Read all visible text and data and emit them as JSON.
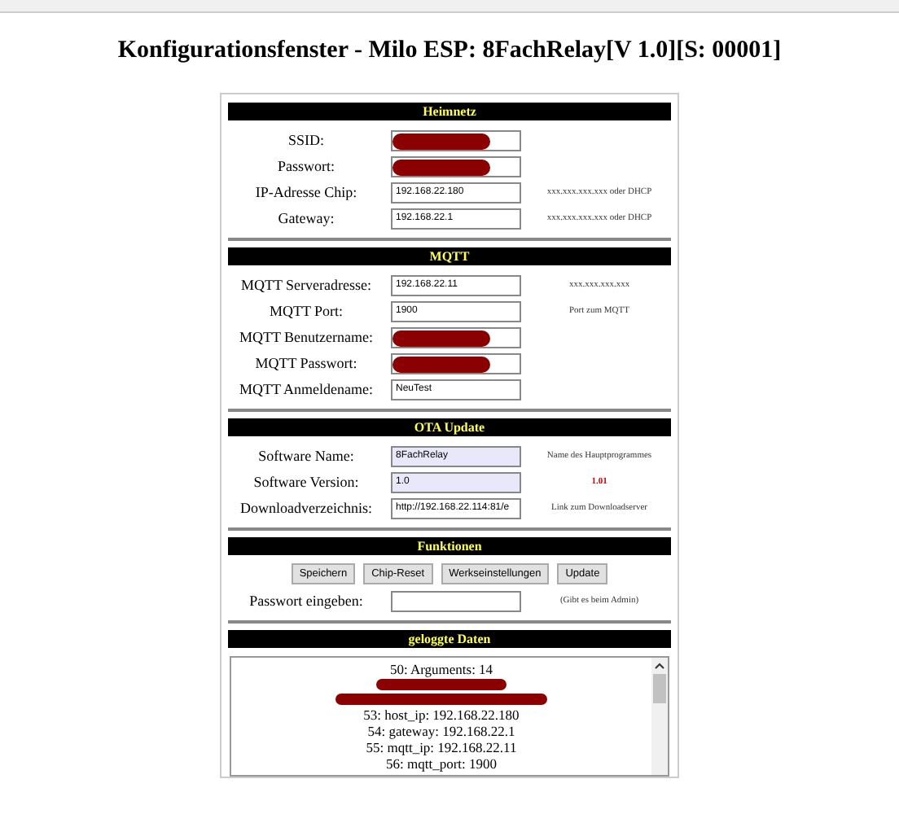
{
  "title": "Konfigurationsfenster - Milo ESP: 8FachRelay[V 1.0][S: 00001]",
  "sections": [
    {
      "heading": "Heimnetz",
      "fields": [
        {
          "label": "SSID:",
          "redacted": true,
          "highlighted": false
        },
        {
          "label": "Passwort:",
          "redacted": true,
          "highlighted": false
        },
        {
          "label": "IP-Adresse Chip:",
          "value": "192.168.22.180",
          "redacted": false,
          "highlighted": false,
          "hint": "xxx.xxx.xxx.xxx oder DHCP"
        },
        {
          "label": "Gateway:",
          "value": "192.168.22.1",
          "redacted": false,
          "highlighted": false,
          "hint": "xxx.xxx.xxx.xxx oder DHCP"
        }
      ]
    },
    {
      "heading": "MQTT",
      "fields": [
        {
          "label": "MQTT Serveradresse:",
          "value": "192.168.22.11",
          "redacted": false,
          "highlighted": false,
          "hint": "xxx.xxx.xxx.xxx"
        },
        {
          "label": "MQTT Port:",
          "value": "1900",
          "redacted": false,
          "highlighted": false,
          "hint": "Port zum MQTT"
        },
        {
          "label": "MQTT Benutzername:",
          "redacted": true,
          "highlighted": false
        },
        {
          "label": "MQTT Passwort:",
          "redacted": true,
          "highlighted": false
        },
        {
          "label": "MQTT Anmeldename:",
          "value": "NeuTest",
          "redacted": false,
          "highlighted": false
        }
      ]
    },
    {
      "heading": "OTA Update",
      "fields": [
        {
          "label": "Software Name:",
          "value": "8FachRelay",
          "redacted": false,
          "highlighted": true,
          "hint": "Name des Hauptprogrammes"
        },
        {
          "label": "Software Version:",
          "value": "1.0",
          "redacted": false,
          "highlighted": true,
          "hint": "1.01",
          "hint_alert": true
        },
        {
          "label": "Downloadverzeichnis:",
          "value": "http://192.168.22.114:81/e",
          "redacted": false,
          "highlighted": false,
          "hint": "Link zum Downloadserver"
        }
      ]
    },
    {
      "heading": "Funktionen",
      "buttons": [
        "Speichern",
        "Chip-Reset",
        "Werkseinstellungen",
        "Update"
      ],
      "fields": [
        {
          "label": "Passwort eingeben:",
          "redacted": false,
          "highlighted": false,
          "hint": "(Gibt es beim Admin)"
        }
      ]
    },
    {
      "heading": "geloggte Daten",
      "log": [
        {
          "text": "50: Arguments: 14",
          "redacted": false
        },
        {
          "redacted": true
        },
        {
          "redacted": true
        },
        {
          "text": "53: host_ip: 192.168.22.180",
          "redacted": false
        },
        {
          "text": "54: gateway: 192.168.22.1",
          "redacted": false
        },
        {
          "text": "55: mqtt_ip: 192.168.22.11",
          "redacted": false
        },
        {
          "text": "56: mqtt_port: 1900",
          "redacted": false
        }
      ]
    }
  ]
}
